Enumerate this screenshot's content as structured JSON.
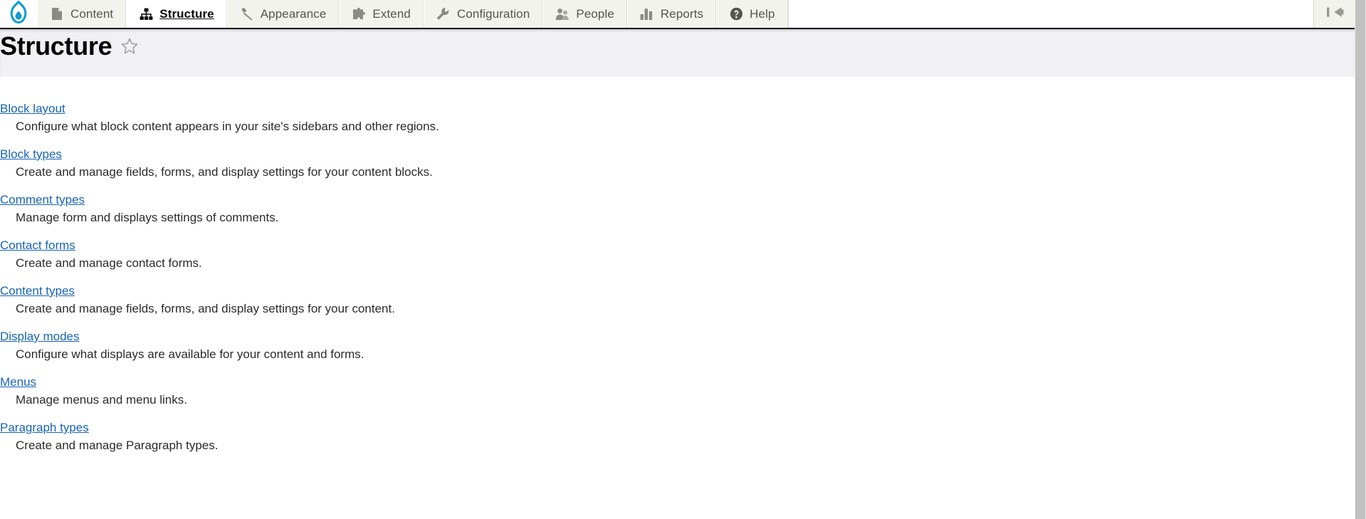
{
  "toolbar": {
    "logo_name": "drupal-droplet-logo",
    "logo_color": "#1399d4",
    "tabs": [
      {
        "label": "Content",
        "icon": "file-icon",
        "active": false
      },
      {
        "label": "Structure",
        "icon": "sitemap-icon",
        "active": true
      },
      {
        "label": "Appearance",
        "icon": "paintbrush-icon",
        "active": false
      },
      {
        "label": "Extend",
        "icon": "puzzle-piece-icon",
        "active": false
      },
      {
        "label": "Configuration",
        "icon": "wrench-icon",
        "active": false
      },
      {
        "label": "People",
        "icon": "people-icon",
        "active": false
      },
      {
        "label": "Reports",
        "icon": "bar-chart-icon",
        "active": false
      },
      {
        "label": "Help",
        "icon": "question-mark-icon",
        "active": false
      }
    ],
    "collapse_icon": "collapse-sidebar-icon"
  },
  "page": {
    "title": "Structure",
    "favorite_icon": "star-outline-icon",
    "title_band_color": "#f0f0f5",
    "link_color": "#1763b6"
  },
  "admin_items": [
    {
      "label": "Block layout",
      "description": "Configure what block content appears in your site's sidebars and other regions."
    },
    {
      "label": "Block types",
      "description": "Create and manage fields, forms, and display settings for your content blocks."
    },
    {
      "label": "Comment types",
      "description": "Manage form and displays settings of comments."
    },
    {
      "label": "Contact forms",
      "description": "Create and manage contact forms."
    },
    {
      "label": "Content types",
      "description": "Create and manage fields, forms, and display settings for your content."
    },
    {
      "label": "Display modes",
      "description": "Configure what displays are available for your content and forms."
    },
    {
      "label": "Menus",
      "description": "Manage menus and menu links."
    },
    {
      "label": "Paragraph types",
      "description": "Create and manage Paragraph types."
    }
  ]
}
